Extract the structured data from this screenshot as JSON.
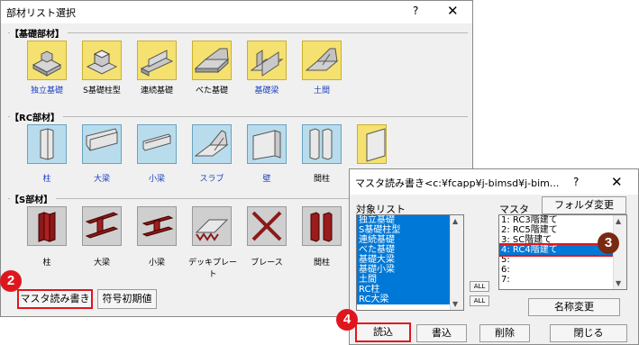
{
  "win1": {
    "title": "部材リスト選択",
    "help": "?",
    "close": "✕",
    "groups": [
      {
        "label": "【基礎部材】",
        "items": [
          {
            "label": "独立基礎",
            "blue_text": true,
            "color": "yellow",
            "icon": "isolated-footing-icon"
          },
          {
            "label": "S基礎柱型",
            "blue_text": false,
            "color": "yellow",
            "icon": "steel-pedestal-icon"
          },
          {
            "label": "連続基礎",
            "blue_text": false,
            "color": "yellow",
            "icon": "strip-footing-icon"
          },
          {
            "label": "べた基礎",
            "blue_text": false,
            "color": "yellow",
            "icon": "mat-foundation-icon"
          },
          {
            "label": "基礎梁",
            "blue_text": true,
            "color": "yellow",
            "icon": "foundation-beam-icon"
          },
          {
            "label": "土間",
            "blue_text": true,
            "color": "yellow",
            "icon": "slab-on-grade-icon"
          }
        ]
      },
      {
        "label": "【RC部材】",
        "items": [
          {
            "label": "柱",
            "blue_text": true,
            "color": "blue",
            "icon": "rc-column-icon"
          },
          {
            "label": "大梁",
            "blue_text": true,
            "color": "blue",
            "icon": "rc-girder-icon"
          },
          {
            "label": "小梁",
            "blue_text": true,
            "color": "blue",
            "icon": "rc-beam-icon"
          },
          {
            "label": "スラブ",
            "blue_text": true,
            "color": "blue",
            "icon": "rc-slab-icon"
          },
          {
            "label": "壁",
            "blue_text": true,
            "color": "blue",
            "icon": "rc-wall-icon"
          },
          {
            "label": "間柱",
            "blue_text": false,
            "color": "blue",
            "icon": "rc-stud-icon"
          },
          {
            "label": "",
            "blue_text": false,
            "color": "yellow",
            "icon": "rc-misc-icon"
          }
        ]
      },
      {
        "label": "【S部材】",
        "items": [
          {
            "label": "柱",
            "blue_text": false,
            "color": "gray",
            "icon": "steel-column-icon"
          },
          {
            "label": "大梁",
            "blue_text": false,
            "color": "gray",
            "icon": "steel-girder-icon"
          },
          {
            "label": "小梁",
            "blue_text": false,
            "color": "gray",
            "icon": "steel-beam-icon"
          },
          {
            "label": "デッキプレート",
            "blue_text": false,
            "color": "gray",
            "icon": "deck-plate-icon"
          },
          {
            "label": "ブレース",
            "blue_text": false,
            "color": "gray",
            "icon": "brace-icon"
          },
          {
            "label": "間柱",
            "blue_text": false,
            "color": "gray",
            "icon": "steel-stud-icon"
          }
        ]
      }
    ],
    "master_button": "マスタ読み書き",
    "init_button": "符号初期値"
  },
  "win2": {
    "title": "マスタ読み書き<c:¥fcapp¥j-bimsd¥j-bim...",
    "help": "?",
    "close": "✕",
    "target_label": "対象リスト",
    "master_label": "マスタ",
    "folder_button": "フォルダ変更",
    "target_list": [
      "独立基礎",
      "S基礎柱型",
      "連続基礎",
      "べた基礎",
      "基礎大梁",
      "基礎小梁",
      "土間",
      "RC柱",
      "RC大梁"
    ],
    "all_label": "ALL",
    "master_list": [
      "1: RC3階建て",
      "2: RC5階建て",
      "3: SC階建て",
      "4: RC4階建て",
      "5:",
      "6:",
      "7:"
    ],
    "master_selected": 3,
    "rename_button": "名称変更",
    "read_button": "読込",
    "write_button": "書込",
    "delete_button": "削除",
    "close_button": "閉じる"
  },
  "badges": [
    "2",
    "3",
    "4"
  ],
  "colors": {
    "selection": "#0078d7",
    "highlight": "#e0161e",
    "badge_brown": "#7a2a10"
  }
}
